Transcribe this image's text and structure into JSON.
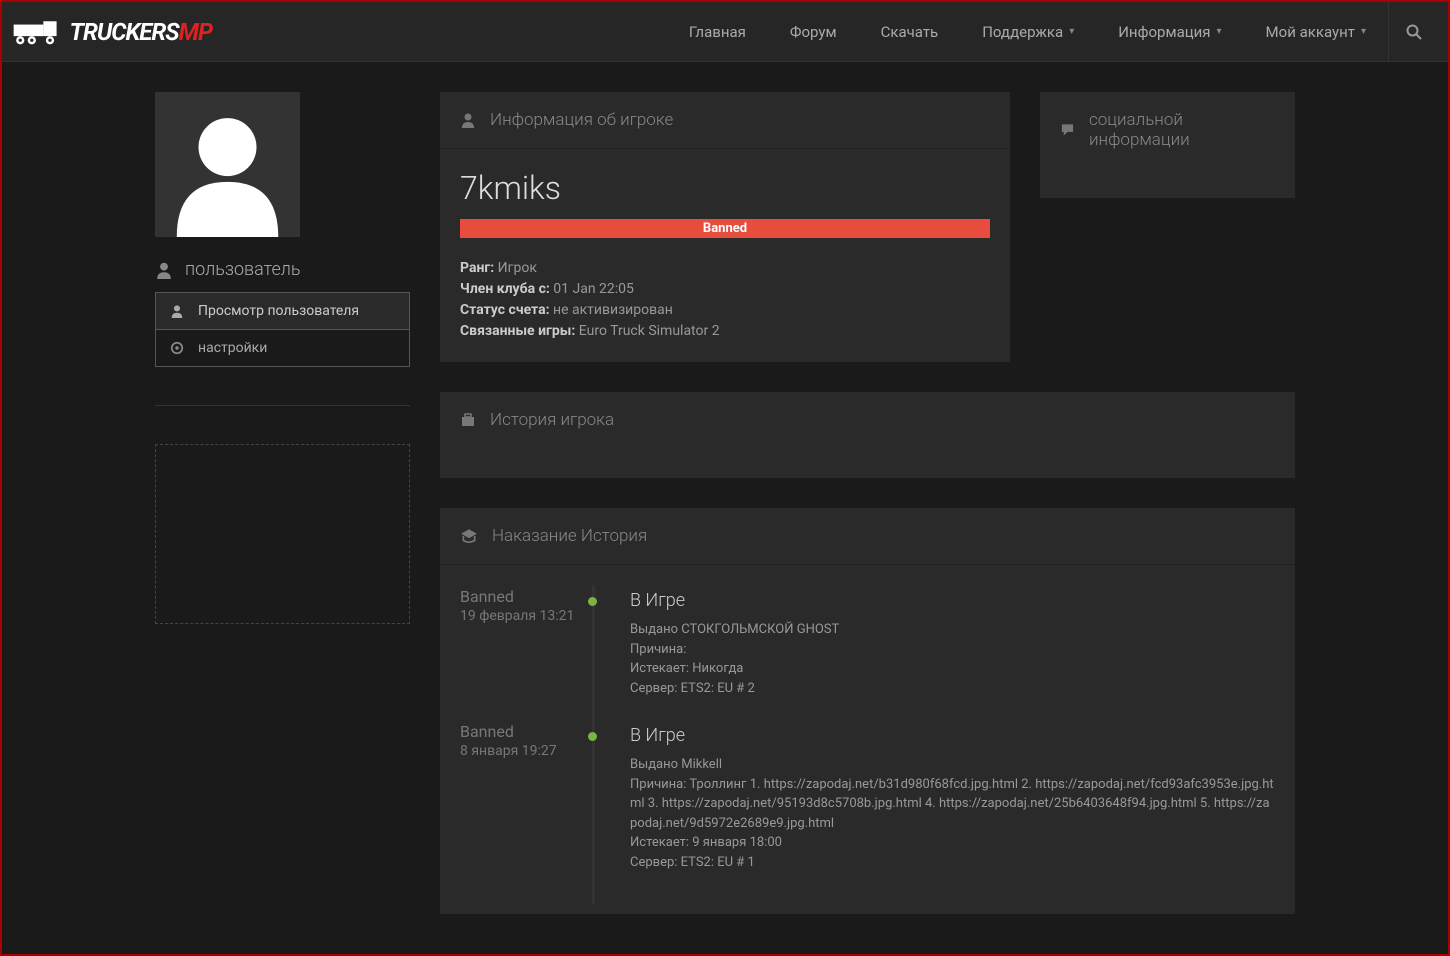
{
  "brand": {
    "name": "TRUCKERS",
    "suffix": "MP"
  },
  "nav": {
    "home": "Главная",
    "forum": "Форум",
    "download": "Скачать",
    "support": "Поддержка",
    "info": "Информация",
    "account": "Мой аккаунт"
  },
  "sidebar": {
    "title": "пользователь",
    "items": [
      {
        "label": "Просмотр пользователя"
      },
      {
        "label": "настройки"
      }
    ]
  },
  "player_info": {
    "heading": "Информация об игроке",
    "name": "7kmiks",
    "banned_label": "Banned",
    "rank_label": "Ранг:",
    "rank_value": "Игрок",
    "member_label": "Член клуба с:",
    "member_value": "01 Jan 22:05",
    "status_label": "Статус счета:",
    "status_value": "не активизирован",
    "games_label": "Связанные игры:",
    "games_value": "Euro Truck Simulator 2"
  },
  "social": {
    "heading": "социальной информации"
  },
  "history": {
    "heading": "История игрока"
  },
  "punishment": {
    "heading": "Наказание История",
    "entries": [
      {
        "status": "Banned",
        "date": "19 февраля 13:21",
        "title": "В Игре",
        "issued": "Выдано СТОКГОЛЬМСКОЙ GHOST",
        "reason": "Причина:",
        "expires": "Истекает: Никогда",
        "server": "Сервер: ETS2: EU # 2"
      },
      {
        "status": "Banned",
        "date": "8 января 19:27",
        "title": "В Игре",
        "issued": "Выдано Mikkell",
        "reason": "Причина: Троллинг 1. https://zapodaj.net/b31d980f68fcd.jpg.html 2. https://zapodaj.net/fcd93afc3953e.jpg.html 3. https://zapodaj.net/95193d8c5708b.jpg.html 4. https://zapodaj.net/25b6403648f94.jpg.html 5. https://zapodaj.net/9d5972e2689e9.jpg.html",
        "expires": "Истекает: 9 января 18:00",
        "server": "Сервер: ETS2: EU # 1"
      }
    ]
  }
}
